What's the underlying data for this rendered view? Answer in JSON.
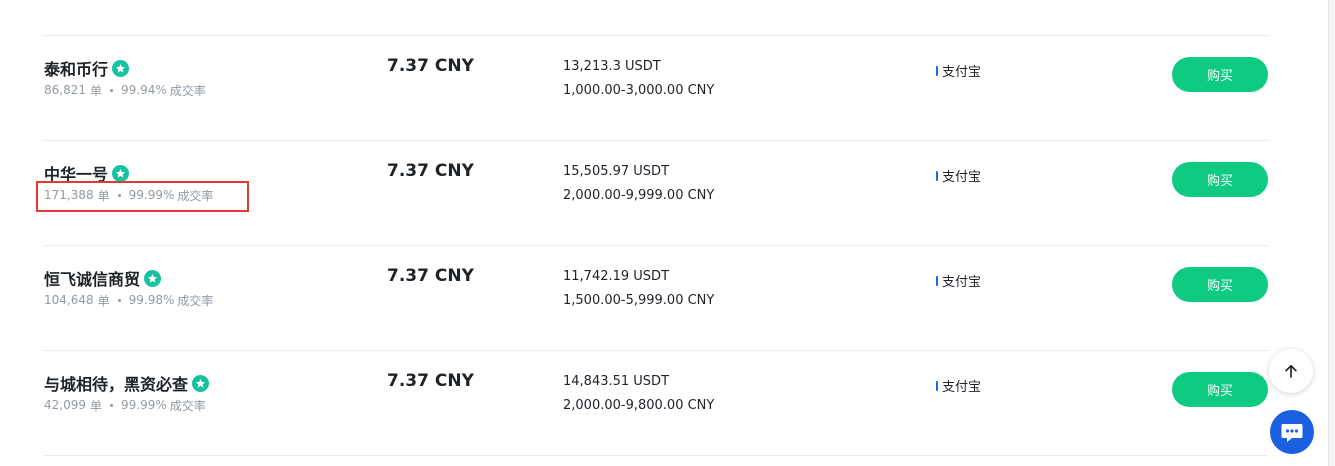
{
  "stats_unit": "单",
  "completion_label": "成交率",
  "buy_label": "购买",
  "colors": {
    "buy_button": "#0ecb81",
    "verify_badge": "#15c3a2",
    "payment_marker": "#1e6ae0",
    "highlight_border": "#e53935",
    "chat_button": "#1a5fe0"
  },
  "icons": {
    "verify": "verified-star-icon",
    "scroll_top": "arrow-up-icon",
    "chat": "chat-bubble-icon"
  },
  "ads": [
    {
      "merchant": "泰和币行",
      "orders": "86,821",
      "completion": "99.94%",
      "price": "7.37 CNY",
      "available": "13,213.3 USDT",
      "limit": "1,000.00-3,000.00 CNY",
      "payment": "支付宝"
    },
    {
      "merchant": "中华一号",
      "orders": "171,388",
      "completion": "99.99%",
      "price": "7.37 CNY",
      "available": "15,505.97 USDT",
      "limit": "2,000.00-9,999.00 CNY",
      "payment": "支付宝"
    },
    {
      "merchant": "恒飞诚信商贸",
      "orders": "104,648",
      "completion": "99.98%",
      "price": "7.37 CNY",
      "available": "11,742.19 USDT",
      "limit": "1,500.00-5,999.00 CNY",
      "payment": "支付宝"
    },
    {
      "merchant": "与城相待，黑资必查",
      "orders": "42,099",
      "completion": "99.99%",
      "price": "7.37 CNY",
      "available": "14,843.51 USDT",
      "limit": "2,000.00-9,800.00 CNY",
      "payment": "支付宝"
    }
  ]
}
